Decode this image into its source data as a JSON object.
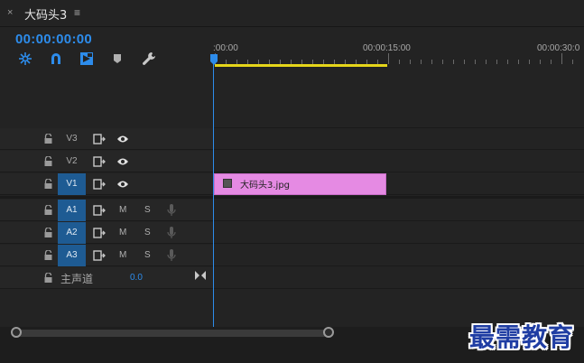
{
  "tab": {
    "close": "×",
    "title": "大码头3",
    "menu": "≡"
  },
  "timecode": "00:00:00:00",
  "toolbar": {
    "icons": [
      "nest-sequence-icon",
      "snap-icon",
      "linked-selection-icon",
      "add-marker-icon",
      "wrench-icon"
    ],
    "accent": "#2d8ceb"
  },
  "ruler": {
    "labels": [
      ":00:00",
      "00:00:15:00",
      "00:00:30:0"
    ]
  },
  "tracks": {
    "video": [
      {
        "name": "V3",
        "targeted": false
      },
      {
        "name": "V2",
        "targeted": false
      },
      {
        "name": "V1",
        "targeted": true
      }
    ],
    "audio": [
      {
        "name": "A1",
        "m": "M",
        "s": "S"
      },
      {
        "name": "A2",
        "m": "M",
        "s": "S"
      },
      {
        "name": "A3",
        "m": "M",
        "s": "S"
      }
    ],
    "master": {
      "name": "主声道",
      "value": "0.0"
    }
  },
  "clip": {
    "name": "大码头3.jpg",
    "color": "#e58ae3"
  },
  "watermark": "最需教育"
}
